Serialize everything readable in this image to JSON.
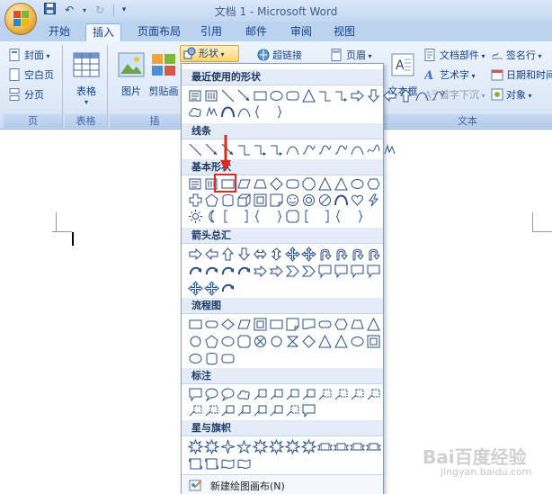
{
  "window": {
    "title": "文档 1 - Microsoft Word"
  },
  "tabs": [
    "开始",
    "插入",
    "页面布局",
    "引用",
    "邮件",
    "审阅",
    "视图"
  ],
  "active_tab": "插入",
  "ribbon": {
    "pages_group": {
      "label": "页",
      "items": [
        "封面",
        "空白页",
        "分页"
      ]
    },
    "table_group": {
      "label": "表格",
      "button": "表格"
    },
    "illustrations_group": {
      "label": "插",
      "picture": "图片",
      "clipart": "剪贴画",
      "shapes": "形状"
    },
    "links_group": {
      "hyperlink": "超链接"
    },
    "header_group": {
      "header": "页眉"
    },
    "text_group": {
      "label": "文本",
      "textbox": "文本框",
      "parts": "文档部件",
      "wordart": "艺术字",
      "dropcap": "首字下沉",
      "signature": "签名行",
      "datetime": "日期和时间",
      "object": "对象"
    }
  },
  "shapes_menu": {
    "sections": [
      "最近使用的形状",
      "线条",
      "基本形状",
      "箭头总汇",
      "流程图",
      "标注",
      "星与旗帜"
    ],
    "footer": "新建绘图画布(N)"
  },
  "colors": {
    "ribbon_bg": "#dce8f7",
    "accent": "#15428b",
    "highlight": "#e0281e"
  },
  "watermark": {
    "main": "Bai百度经验",
    "sub": "jingyan.baidu.com"
  }
}
